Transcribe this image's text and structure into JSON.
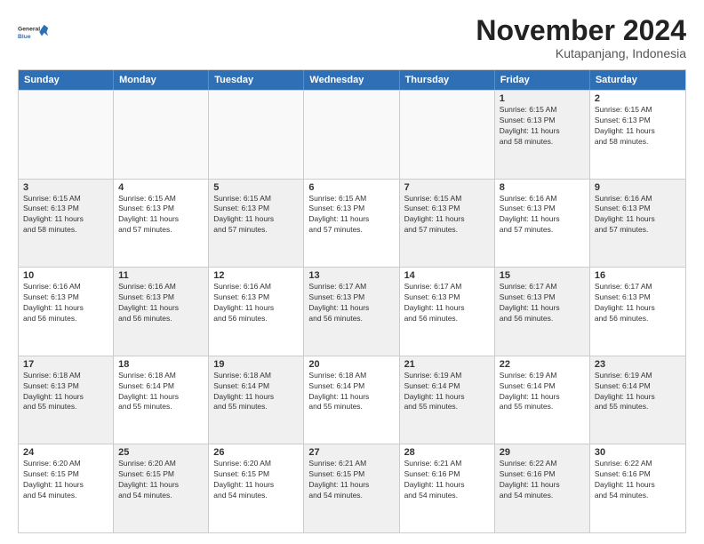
{
  "logo": {
    "line1": "General",
    "line2": "Blue"
  },
  "title": "November 2024",
  "subtitle": "Kutapanjang, Indonesia",
  "header_days": [
    "Sunday",
    "Monday",
    "Tuesday",
    "Wednesday",
    "Thursday",
    "Friday",
    "Saturday"
  ],
  "rows": [
    [
      {
        "day": "",
        "info": "",
        "shaded": false,
        "empty": true
      },
      {
        "day": "",
        "info": "",
        "shaded": false,
        "empty": true
      },
      {
        "day": "",
        "info": "",
        "shaded": false,
        "empty": true
      },
      {
        "day": "",
        "info": "",
        "shaded": false,
        "empty": true
      },
      {
        "day": "",
        "info": "",
        "shaded": false,
        "empty": true
      },
      {
        "day": "1",
        "info": "Sunrise: 6:15 AM\nSunset: 6:13 PM\nDaylight: 11 hours\nand 58 minutes.",
        "shaded": true,
        "empty": false
      },
      {
        "day": "2",
        "info": "Sunrise: 6:15 AM\nSunset: 6:13 PM\nDaylight: 11 hours\nand 58 minutes.",
        "shaded": false,
        "empty": false
      }
    ],
    [
      {
        "day": "3",
        "info": "Sunrise: 6:15 AM\nSunset: 6:13 PM\nDaylight: 11 hours\nand 58 minutes.",
        "shaded": true,
        "empty": false
      },
      {
        "day": "4",
        "info": "Sunrise: 6:15 AM\nSunset: 6:13 PM\nDaylight: 11 hours\nand 57 minutes.",
        "shaded": false,
        "empty": false
      },
      {
        "day": "5",
        "info": "Sunrise: 6:15 AM\nSunset: 6:13 PM\nDaylight: 11 hours\nand 57 minutes.",
        "shaded": true,
        "empty": false
      },
      {
        "day": "6",
        "info": "Sunrise: 6:15 AM\nSunset: 6:13 PM\nDaylight: 11 hours\nand 57 minutes.",
        "shaded": false,
        "empty": false
      },
      {
        "day": "7",
        "info": "Sunrise: 6:15 AM\nSunset: 6:13 PM\nDaylight: 11 hours\nand 57 minutes.",
        "shaded": true,
        "empty": false
      },
      {
        "day": "8",
        "info": "Sunrise: 6:16 AM\nSunset: 6:13 PM\nDaylight: 11 hours\nand 57 minutes.",
        "shaded": false,
        "empty": false
      },
      {
        "day": "9",
        "info": "Sunrise: 6:16 AM\nSunset: 6:13 PM\nDaylight: 11 hours\nand 57 minutes.",
        "shaded": true,
        "empty": false
      }
    ],
    [
      {
        "day": "10",
        "info": "Sunrise: 6:16 AM\nSunset: 6:13 PM\nDaylight: 11 hours\nand 56 minutes.",
        "shaded": false,
        "empty": false
      },
      {
        "day": "11",
        "info": "Sunrise: 6:16 AM\nSunset: 6:13 PM\nDaylight: 11 hours\nand 56 minutes.",
        "shaded": true,
        "empty": false
      },
      {
        "day": "12",
        "info": "Sunrise: 6:16 AM\nSunset: 6:13 PM\nDaylight: 11 hours\nand 56 minutes.",
        "shaded": false,
        "empty": false
      },
      {
        "day": "13",
        "info": "Sunrise: 6:17 AM\nSunset: 6:13 PM\nDaylight: 11 hours\nand 56 minutes.",
        "shaded": true,
        "empty": false
      },
      {
        "day": "14",
        "info": "Sunrise: 6:17 AM\nSunset: 6:13 PM\nDaylight: 11 hours\nand 56 minutes.",
        "shaded": false,
        "empty": false
      },
      {
        "day": "15",
        "info": "Sunrise: 6:17 AM\nSunset: 6:13 PM\nDaylight: 11 hours\nand 56 minutes.",
        "shaded": true,
        "empty": false
      },
      {
        "day": "16",
        "info": "Sunrise: 6:17 AM\nSunset: 6:13 PM\nDaylight: 11 hours\nand 56 minutes.",
        "shaded": false,
        "empty": false
      }
    ],
    [
      {
        "day": "17",
        "info": "Sunrise: 6:18 AM\nSunset: 6:13 PM\nDaylight: 11 hours\nand 55 minutes.",
        "shaded": true,
        "empty": false
      },
      {
        "day": "18",
        "info": "Sunrise: 6:18 AM\nSunset: 6:14 PM\nDaylight: 11 hours\nand 55 minutes.",
        "shaded": false,
        "empty": false
      },
      {
        "day": "19",
        "info": "Sunrise: 6:18 AM\nSunset: 6:14 PM\nDaylight: 11 hours\nand 55 minutes.",
        "shaded": true,
        "empty": false
      },
      {
        "day": "20",
        "info": "Sunrise: 6:18 AM\nSunset: 6:14 PM\nDaylight: 11 hours\nand 55 minutes.",
        "shaded": false,
        "empty": false
      },
      {
        "day": "21",
        "info": "Sunrise: 6:19 AM\nSunset: 6:14 PM\nDaylight: 11 hours\nand 55 minutes.",
        "shaded": true,
        "empty": false
      },
      {
        "day": "22",
        "info": "Sunrise: 6:19 AM\nSunset: 6:14 PM\nDaylight: 11 hours\nand 55 minutes.",
        "shaded": false,
        "empty": false
      },
      {
        "day": "23",
        "info": "Sunrise: 6:19 AM\nSunset: 6:14 PM\nDaylight: 11 hours\nand 55 minutes.",
        "shaded": true,
        "empty": false
      }
    ],
    [
      {
        "day": "24",
        "info": "Sunrise: 6:20 AM\nSunset: 6:15 PM\nDaylight: 11 hours\nand 54 minutes.",
        "shaded": false,
        "empty": false
      },
      {
        "day": "25",
        "info": "Sunrise: 6:20 AM\nSunset: 6:15 PM\nDaylight: 11 hours\nand 54 minutes.",
        "shaded": true,
        "empty": false
      },
      {
        "day": "26",
        "info": "Sunrise: 6:20 AM\nSunset: 6:15 PM\nDaylight: 11 hours\nand 54 minutes.",
        "shaded": false,
        "empty": false
      },
      {
        "day": "27",
        "info": "Sunrise: 6:21 AM\nSunset: 6:15 PM\nDaylight: 11 hours\nand 54 minutes.",
        "shaded": true,
        "empty": false
      },
      {
        "day": "28",
        "info": "Sunrise: 6:21 AM\nSunset: 6:16 PM\nDaylight: 11 hours\nand 54 minutes.",
        "shaded": false,
        "empty": false
      },
      {
        "day": "29",
        "info": "Sunrise: 6:22 AM\nSunset: 6:16 PM\nDaylight: 11 hours\nand 54 minutes.",
        "shaded": true,
        "empty": false
      },
      {
        "day": "30",
        "info": "Sunrise: 6:22 AM\nSunset: 6:16 PM\nDaylight: 11 hours\nand 54 minutes.",
        "shaded": false,
        "empty": false
      }
    ]
  ]
}
